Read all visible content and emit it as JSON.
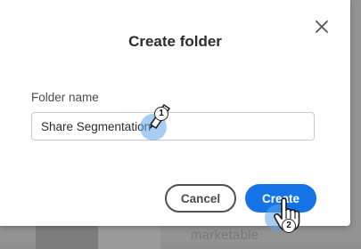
{
  "dialog": {
    "title": "Create folder",
    "field_label": "Folder name",
    "field_value": "Share Segmentation",
    "cancel_label": "Cancel",
    "create_label": "Create",
    "accent_color": "#1473e6"
  },
  "annotations": {
    "step1": "1",
    "step2": "2"
  },
  "background": {
    "partial_text": "marketable"
  },
  "icons": {
    "close": "close-icon",
    "pencil": "pencil-cursor-icon",
    "hand": "hand-pointer-icon"
  }
}
